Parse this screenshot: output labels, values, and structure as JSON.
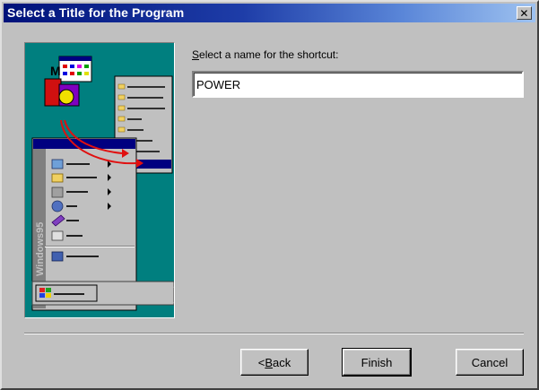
{
  "window": {
    "title": "Select a Title for the Program",
    "close_glyph": "✕"
  },
  "form": {
    "prompt_accesskey": "S",
    "prompt_rest": "elect a name for the shortcut:",
    "shortcut_name": "POWER"
  },
  "buttons": {
    "back_accesskey": "B",
    "back_rest": "ack",
    "back_prefix": "< ",
    "finish": "Finish",
    "cancel": "Cancel"
  },
  "illustration": {
    "side_label": "Windows95",
    "icons": [
      "start-menu-icon",
      "program-folder-icon",
      "arrow-icon"
    ],
    "colors": {
      "desktop": "#007f7f",
      "menu_highlight": "#000080",
      "arrow": "#e01010"
    }
  }
}
